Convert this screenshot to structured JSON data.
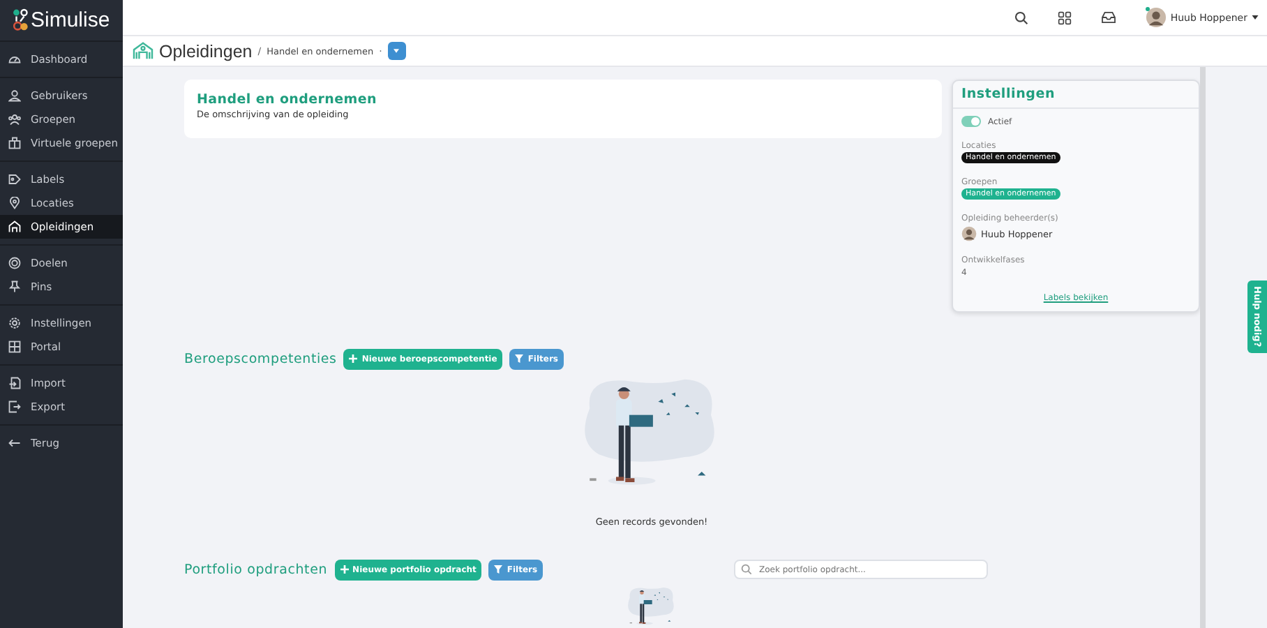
{
  "app": {
    "logo": "Simulise"
  },
  "header": {
    "user": "Huub Hoppener",
    "online": true
  },
  "sidebar": {
    "groups": [
      [
        {
          "label": "Dashboard",
          "selected": false
        }
      ],
      [
        {
          "label": "Gebruikers",
          "selected": false
        },
        {
          "label": "Groepen",
          "selected": false
        },
        {
          "label": "Virtuele groepen",
          "selected": false
        }
      ],
      [
        {
          "label": "Labels",
          "selected": false
        },
        {
          "label": "Locaties",
          "selected": false
        },
        {
          "label": "Opleidingen",
          "selected": true
        }
      ],
      [
        {
          "label": "Doelen",
          "selected": false
        },
        {
          "label": "Pins",
          "selected": false
        }
      ],
      [
        {
          "label": "Instellingen",
          "selected": false
        },
        {
          "label": "Portal",
          "selected": false
        }
      ],
      [
        {
          "label": "Import",
          "selected": false
        },
        {
          "label": "Export",
          "selected": false
        }
      ],
      [
        {
          "label": "Terug",
          "selected": false
        }
      ]
    ]
  },
  "breadcrumb": {
    "title": "Opleidingen",
    "separator": "/",
    "current": "Handel en ondernemen",
    "trailing": "·"
  },
  "course": {
    "title": "Handel en ondernemen",
    "description": "De omschrijving van de opleiding"
  },
  "settings": {
    "title": "Instellingen",
    "active": {
      "label": "Actief",
      "on": true
    },
    "locations": {
      "label": "Locaties",
      "tags": [
        "Handel en ondernemen"
      ]
    },
    "groups": {
      "label": "Groepen",
      "tags": [
        "Handel en ondernemen"
      ]
    },
    "managers": {
      "label": "Opleiding beheerder(s)",
      "names": [
        "Huub Hoppener"
      ]
    },
    "phases": {
      "label": "Ontwikkelfases",
      "value": "4"
    },
    "link": "Labels bekijken"
  },
  "help_tab": "Hulp nodig?",
  "sections": [
    {
      "title": "Beroepscompetenties",
      "add_button": "Nieuwe beroepscompetentie",
      "filter_button": "Filters",
      "empty_text": "Geen records gevonden!"
    },
    {
      "title": "Portfolio opdrachten",
      "add_button": "Nieuwe portfolio opdracht",
      "filter_button": "Filters",
      "search_placeholder": "Zoek portfolio opdracht..."
    }
  ]
}
